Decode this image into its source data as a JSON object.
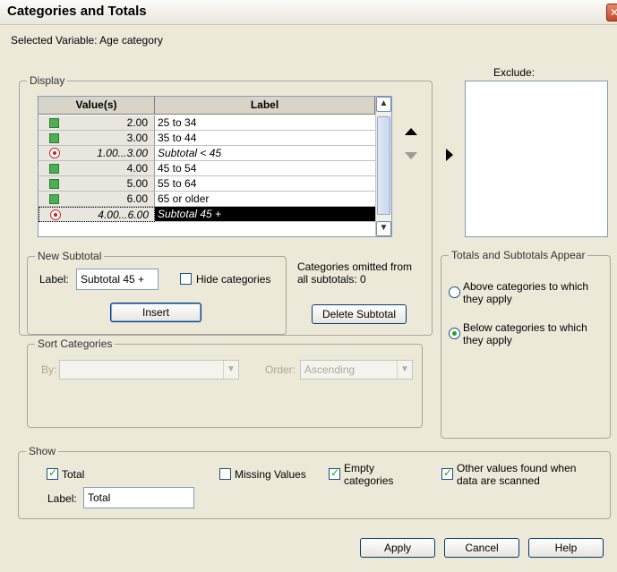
{
  "window": {
    "title": "Categories and Totals",
    "close_icon": "close-icon"
  },
  "selected_variable": "Selected Variable: Age category",
  "display": {
    "legend": "Display",
    "columns": [
      "Value(s)",
      "Label"
    ],
    "rows": [
      {
        "value": "2.00",
        "label": "25 to 34",
        "icon": "green-square-icon",
        "subtotal": false,
        "selected": false
      },
      {
        "value": "3.00",
        "label": "35 to 44",
        "icon": "green-square-icon",
        "subtotal": false,
        "selected": false
      },
      {
        "value": "1.00...3.00",
        "label": "Subtotal < 45",
        "icon": "subtotal-icon",
        "subtotal": true,
        "selected": false
      },
      {
        "value": "4.00",
        "label": "45 to 54",
        "icon": "green-square-icon",
        "subtotal": false,
        "selected": false
      },
      {
        "value": "5.00",
        "label": "55 to 64",
        "icon": "green-square-icon",
        "subtotal": false,
        "selected": false
      },
      {
        "value": "6.00",
        "label": "65 or older",
        "icon": "green-square-icon",
        "subtotal": false,
        "selected": false
      },
      {
        "value": "4.00...6.00",
        "label": "Subtotal 45 +",
        "icon": "subtotal-icon",
        "subtotal": true,
        "selected": true
      }
    ]
  },
  "exclude": {
    "label": "Exclude:"
  },
  "new_subtotal": {
    "legend": "New Subtotal",
    "label_prefix": "Label:",
    "label_value": "Subtotal 45 +",
    "hide_categories": "Hide categories",
    "insert": "Insert"
  },
  "omitted_note": "Categories omitted from all subtotals: 0",
  "delete_subtotal": "Delete Subtotal",
  "sort": {
    "legend": "Sort Categories",
    "by_label": "By:",
    "by_value": "",
    "order_label": "Order:",
    "order_value": "Ascending"
  },
  "totals_appear": {
    "legend": "Totals and Subtotals Appear",
    "above": "Above categories to which they apply",
    "below": "Below categories to which they apply",
    "selected": "below"
  },
  "show": {
    "legend": "Show",
    "total": "Total",
    "total_checked": true,
    "label_prefix": "Label:",
    "label_value": "Total",
    "missing_values": "Missing Values",
    "missing_checked": false,
    "empty_categories": "Empty categories",
    "empty_checked": true,
    "other_values": "Other values found when data are scanned",
    "other_checked": true
  },
  "buttons": {
    "apply": "Apply",
    "cancel": "Cancel",
    "help": "Help"
  },
  "colors": {
    "background": "#ece9d8",
    "selection": "#000000",
    "category_square": "#4caf50",
    "subtotal_dot": "#d02020",
    "check": "#21a121"
  }
}
